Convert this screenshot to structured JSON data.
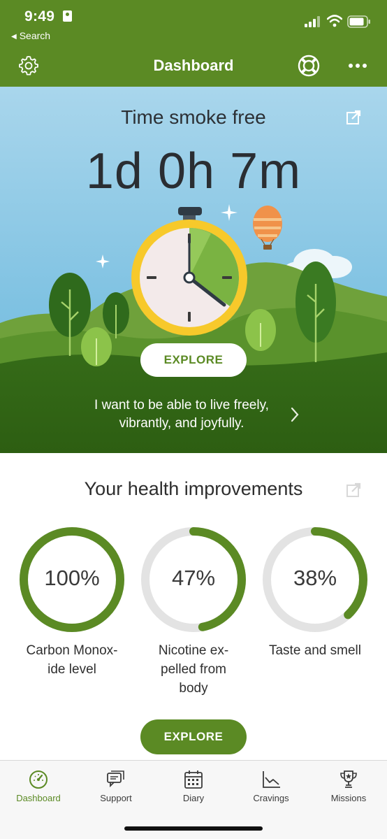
{
  "status_bar": {
    "time": "9:49",
    "back_label": "Search"
  },
  "nav": {
    "title": "Dashboard",
    "left_icon": "gear-icon",
    "right_icons": [
      "lifebuoy-icon",
      "more-icon"
    ]
  },
  "hero": {
    "title": "Time smoke free",
    "timer": "1d 0h 7m",
    "explore_label": "EXPLORE",
    "goal_line1": "I want to be able to live freely,",
    "goal_line2": "vibrantly, and joyfully."
  },
  "health": {
    "title": "Your health improvements",
    "items": [
      {
        "value": "100%",
        "fraction": 1.0,
        "label_line1": "Carbon Monox-",
        "label_line2": "ide level",
        "label_line3": ""
      },
      {
        "value": "47%",
        "fraction": 0.47,
        "label_line1": "Nicotine ex-",
        "label_line2": "pelled from",
        "label_line3": "body"
      },
      {
        "value": "38%",
        "fraction": 0.38,
        "label_line1": "Taste and smell",
        "label_line2": "",
        "label_line3": ""
      }
    ],
    "explore_label": "EXPLORE"
  },
  "tabs": [
    {
      "label": "Dashboard",
      "icon": "speedometer-icon",
      "active": true
    },
    {
      "label": "Support",
      "icon": "chat-icon",
      "active": false
    },
    {
      "label": "Diary",
      "icon": "calendar-icon",
      "active": false
    },
    {
      "label": "Cravings",
      "icon": "chart-icon",
      "active": false
    },
    {
      "label": "Missions",
      "icon": "trophy-icon",
      "active": false
    }
  ],
  "colors": {
    "brand_green": "#5b8a24",
    "ring_track": "#e3e3e3",
    "sky": "#8fcbe6"
  }
}
